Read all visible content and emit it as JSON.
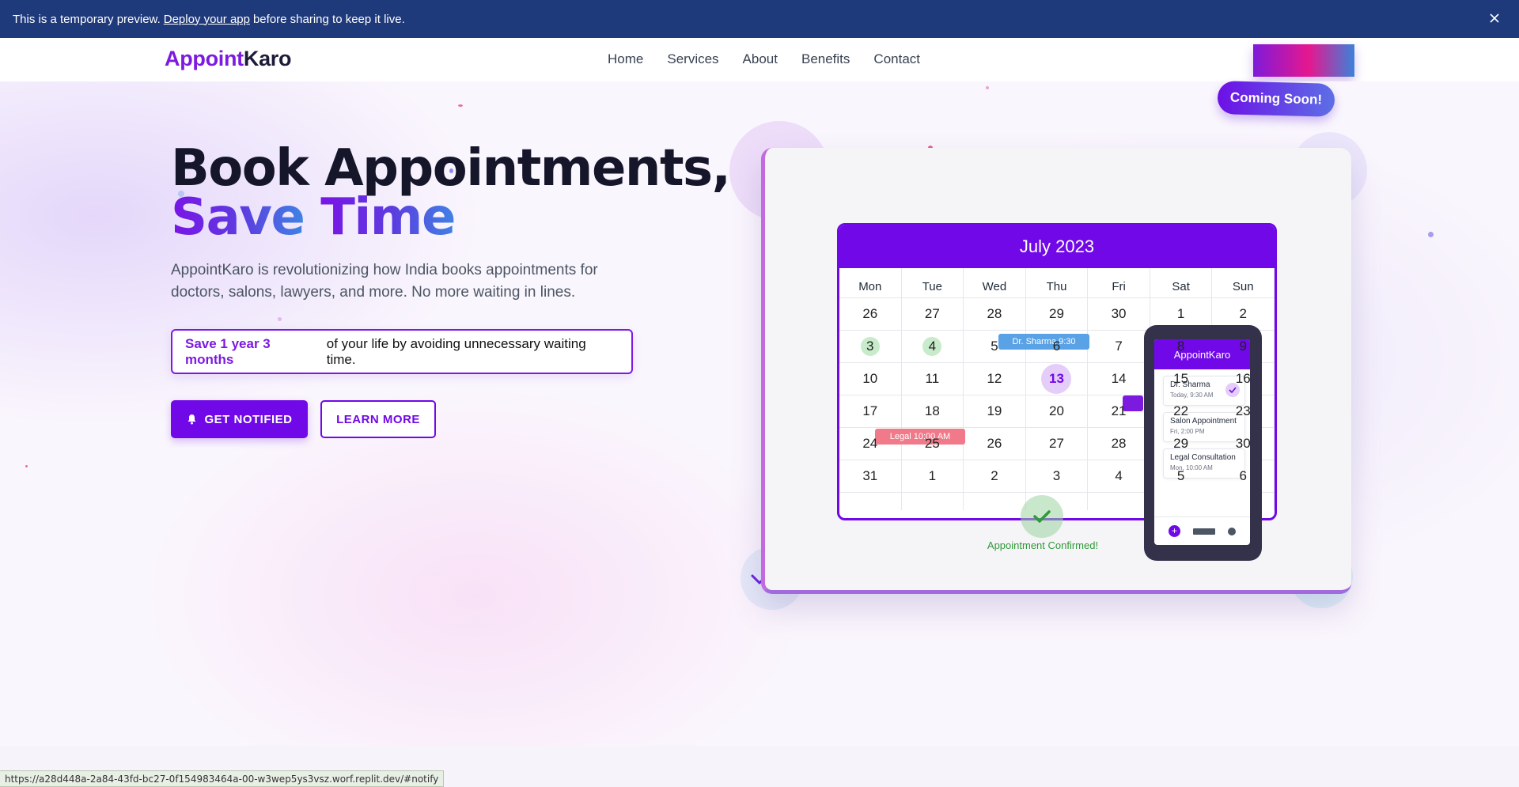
{
  "banner": {
    "text_before": "This is a temporary preview.",
    "link": "Deploy your app",
    "text_after": "before sharing to keep it live."
  },
  "nav": {
    "logo_part1": "Appoint",
    "logo_part2": "Karo",
    "items": [
      "Home",
      "Services",
      "About",
      "Benefits",
      "Contact"
    ],
    "button_colors": [
      "#7e1ad9",
      "#e6178f",
      "#3b82d9"
    ]
  },
  "hero": {
    "title_line1": "Book Appointments,",
    "title_word_save": "Save",
    "title_word_time": "Time",
    "description": "AppointKaro is revolutionizing how India books appointments for doctors, salons, lawyers, and more. No more waiting in lines.",
    "save_highlight": "Save 1 year 3 months",
    "save_rest": "of your life by avoiding unnecessary waiting time.",
    "notify_button": "GET NOTIFIED",
    "learn_button": "LEARN MORE"
  },
  "calendar": {
    "badge": "Coming Soon!",
    "month": "July 2023",
    "weekdays": [
      "Mon",
      "Tue",
      "Wed",
      "Thu",
      "Fri",
      "Sat",
      "Sun"
    ],
    "days": [
      "26",
      "27",
      "28",
      "29",
      "30",
      "1",
      "2",
      "3",
      "4",
      "5",
      "6",
      "7",
      "8",
      "9",
      "10",
      "11",
      "12",
      "13",
      "14",
      "15",
      "16",
      "17",
      "18",
      "19",
      "20",
      "21",
      "22",
      "23",
      "24",
      "25",
      "26",
      "27",
      "28",
      "29",
      "30",
      "31",
      "1",
      "2",
      "3",
      "4",
      "5",
      "6"
    ],
    "today": "13",
    "events": {
      "sharma": "Dr. Sharma 9:30",
      "legal": "Legal 10:00 AM"
    },
    "confirmed": "Appointment Confirmed!"
  },
  "phone": {
    "title": "AppointKaro",
    "items": [
      {
        "title": "Dr. Sharma",
        "sub": "Today, 9:30 AM"
      },
      {
        "title": "Salon Appointment",
        "sub": "Fri, 2:00 PM"
      },
      {
        "title": "Legal Consultation",
        "sub": "Mon, 10:00 AM"
      }
    ]
  },
  "status_bar": "https://a28d448a-2a84-43fd-bc27-0f154983464a-00-w3wep5ys3vsz.worf.replit.dev/#notify",
  "colors": {
    "primary": "#7008e7",
    "banner": "#1f3a7a",
    "event_blue": "#5aa2e6",
    "event_red": "#f17a8a",
    "confirm_green": "#2f9a3a"
  }
}
